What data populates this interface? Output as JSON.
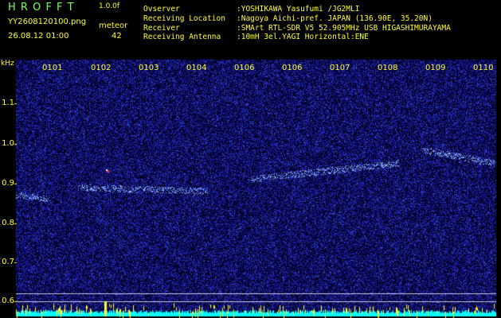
{
  "header": {
    "app_title": "H R O F F T",
    "version": "1.0.0f",
    "filename": "YY2608120100.png",
    "datetime": "26.08.12 01:00",
    "meteor_label": "meteor",
    "meteor_count": "42",
    "info": [
      {
        "label": "Ovserver",
        "value": ":YOSHIKAWA Yasufumi /JG2MLI"
      },
      {
        "label": "Receiving Location",
        "value": ":Nagoya Aichi-pref. JAPAN (136.90E, 35.20N)"
      },
      {
        "label": "Receiver",
        "value": ":SMArt RTL-SDR V5 52.905MHz USB HIGASHIMURAYAMA"
      },
      {
        "label": "Receiving Antenna",
        "value": ":10mH 3el.YAGI Horizontal:ENE"
      }
    ]
  },
  "axis": {
    "unit": "kHz",
    "y_ticks": [
      "1.1",
      "1.0",
      "0.9",
      "0.8",
      "0.7",
      "0.6"
    ],
    "x_ticks": [
      "0101",
      "0102",
      "0103",
      "0104",
      "0106",
      "0106",
      "0107",
      "0108",
      "0109",
      "0110"
    ]
  },
  "colors": {
    "background": "#000000",
    "noise": "#1e1eb4",
    "signal": "#a0c8ff",
    "label_green": "#7cff5a",
    "label_yellow": "#ffff33",
    "baseline_cyan": "#00ffff"
  }
}
